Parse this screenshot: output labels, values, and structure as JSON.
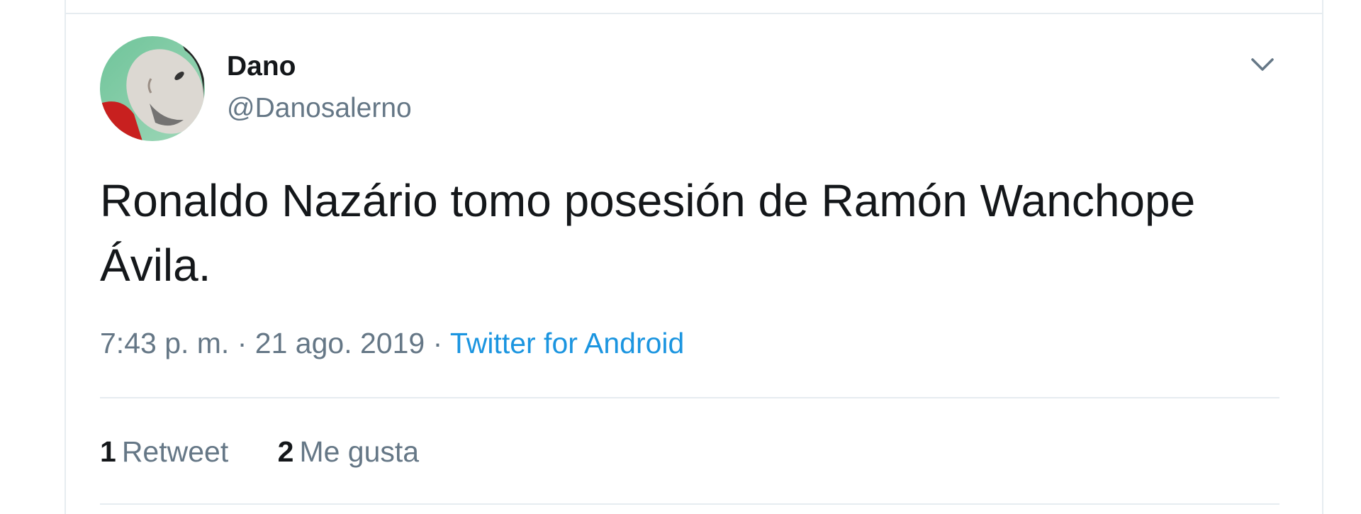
{
  "tweet": {
    "author": {
      "name": "Dano",
      "handle": "@Danosalerno",
      "avatar_icon": "profile-photo-avatar"
    },
    "menu_icon": "chevron-down-icon",
    "text": "Ronaldo Nazário tomo posesión de Ramón Wanchope Ávila.",
    "time": "7:43 p. m.",
    "separator": "·",
    "date": "21 ago. 2019",
    "source": "Twitter for Android",
    "stats": {
      "retweets": {
        "count": "1",
        "label": "Retweet"
      },
      "likes": {
        "count": "2",
        "label": "Me gusta"
      }
    }
  },
  "colors": {
    "primary_text": "#14171a",
    "secondary_text": "#657786",
    "link": "#1b95e0",
    "divider": "#e6ecf0"
  }
}
